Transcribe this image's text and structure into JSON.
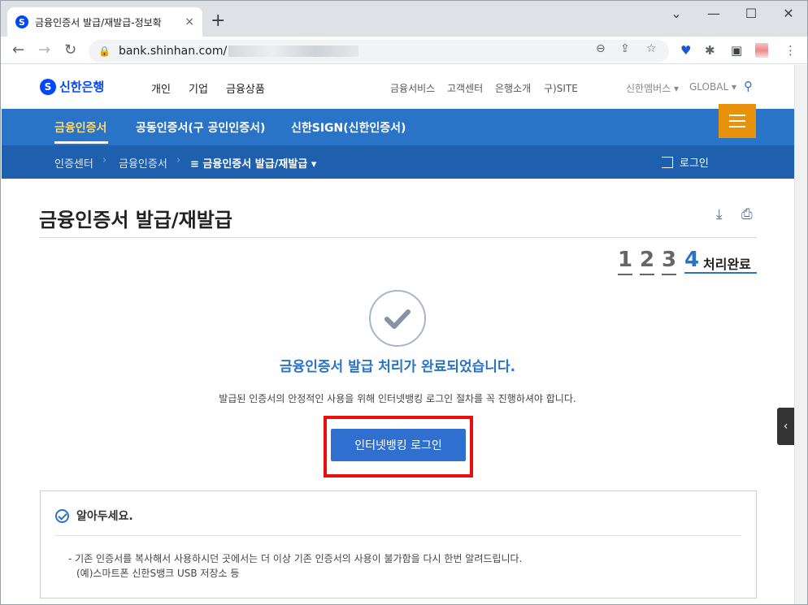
{
  "browser": {
    "tab_title": "금융인증서 발급/재발급-정보확",
    "tab_close": "×",
    "new_tab": "+",
    "url": "bank.shinhan.com/",
    "window_controls": [
      "⌄",
      "—",
      "☐",
      "✕"
    ]
  },
  "header": {
    "logo": "신한은행",
    "logo_mark": "S",
    "main_menu": [
      "개인",
      "기업",
      "금융상품"
    ],
    "util_menu": [
      "금융서비스",
      "고객센터",
      "은행소개",
      "구)SITE"
    ],
    "member": "신한멤버스 ▾",
    "global": "GLOBAL ▾"
  },
  "nav": {
    "items": [
      "금융인증서",
      "공동인증서(구 공인인증서)",
      "신한SIGN(신한인증서)"
    ],
    "active_index": 0
  },
  "breadcrumb": {
    "items": [
      "인증센터",
      "금융인증서"
    ],
    "current": "≡ 금융인증서 발급/재발급 ▾",
    "login": "로그인"
  },
  "page": {
    "title": "금융인증서 발급/재발급",
    "steps": [
      "1",
      "2",
      "3",
      "4"
    ],
    "current_step_label": "처리완료",
    "success_title": "금융인증서 발급 처리가 완료되었습니다.",
    "success_desc": "발급된 인증서의 안정적인 사용을 위해 인터넷뱅킹 로그인 절차를 꼭 진행하셔야 합니다.",
    "login_button": "인터넷뱅킹 로그인"
  },
  "notice": {
    "title": "알아두세요.",
    "line1": "- 기존 인증서를 복사해서 사용하시던 곳에서는 더 이상 기존 인증서의 사용이 불가함을 다시 한번 알려드립니다.",
    "line2": "(예)스마트폰 신한S뱅크 USB 저장소 등"
  },
  "colors": {
    "brand_blue": "#2a74c8",
    "breadcrumb_blue": "#1e5fae",
    "menu_orange": "#e8910b",
    "highlight_red": "#ec0d0d"
  }
}
